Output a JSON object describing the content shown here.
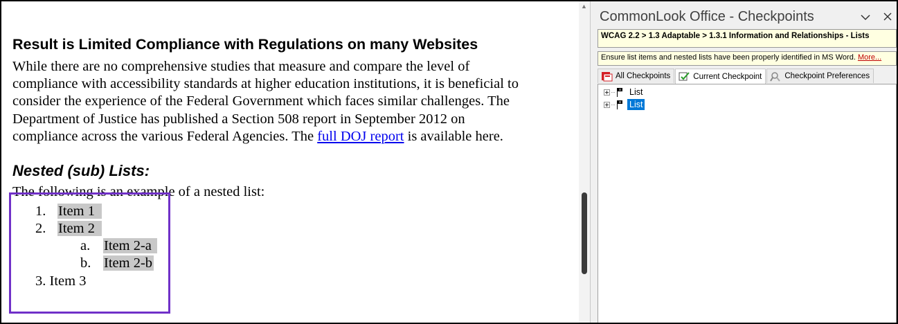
{
  "document": {
    "heading": "Result is Limited Compliance with Regulations on many Websites",
    "paragraph_lines": [
      "While there are no comprehensive studies that measure and compare the level of",
      "compliance with accessibility standards at higher education institutions, it is beneficial to",
      "consider the experience of the Federal Government which faces similar challenges. The",
      "Department of Justice has published a Section 508 report in September 2012 on"
    ],
    "last_line_before_link": "compliance across the various Federal Agencies.  The ",
    "link_text": "full DOJ report",
    "last_line_after_link": " is available here.",
    "sub_heading": "Nested (sub) Lists:",
    "intro": "The following is an example of a nested list:",
    "list": {
      "item1_num": "1.",
      "item1": "Item 1",
      "item2_num": "2.",
      "item2": "Item 2",
      "item2a_num": "a.",
      "item2a": "Item 2-a",
      "item2b_num": "b.",
      "item2b": "Item 2-b",
      "item3": "3. Item 3"
    },
    "highlight_color": "#c8c8c8",
    "focus_color": "#7030c8"
  },
  "pane": {
    "title": "CommonLook Office - Checkpoints",
    "breadcrumb": "WCAG 2.2 > 1.3 Adaptable > 1.3.1 Information and Relationships - Lists",
    "description": "Ensure list items and nested lists have been properly identified in MS Word.",
    "more_link": "More...",
    "tabs": [
      {
        "label": "All Checkpoints",
        "icon": "all-checkpoints-icon"
      },
      {
        "label": "Current Checkpoint",
        "icon": "current-checkpoint-icon"
      },
      {
        "label": "Checkpoint Preferences",
        "icon": "preferences-icon"
      }
    ],
    "active_tab": "Current Checkpoint",
    "tree": [
      {
        "label": "List",
        "selected": false
      },
      {
        "label": "List",
        "selected": true
      }
    ],
    "selection_color": "#0078d7"
  }
}
